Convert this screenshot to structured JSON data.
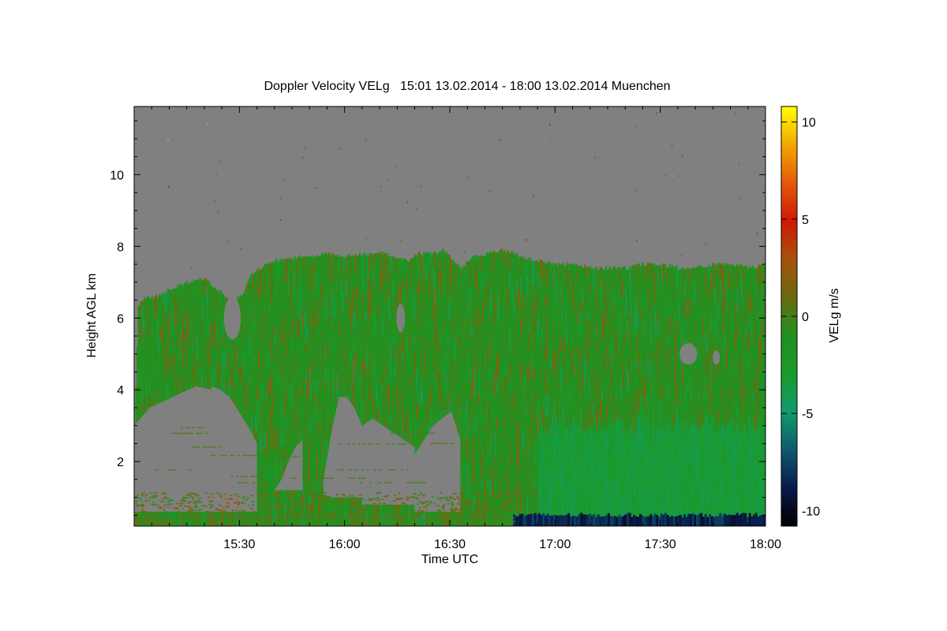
{
  "chart_data": {
    "type": "heatmap",
    "title": "Doppler Velocity VELg   15:01 13.02.2014 - 18:00 13.02.2014 Muenchen",
    "xlabel": "Time UTC",
    "ylabel": "Height AGL km",
    "colorbar_label": "VELg m/s",
    "x_tick_labels": [
      "15:30",
      "16:00",
      "16:30",
      "17:00",
      "17:30",
      "18:00"
    ],
    "x_tick_minutes": [
      30,
      60,
      90,
      120,
      150,
      180
    ],
    "xlim_minutes": [
      0,
      180
    ],
    "y_ticks": [
      2,
      4,
      6,
      8,
      10
    ],
    "y_tick_labels": [
      "2",
      "4",
      "6",
      "8",
      "10"
    ],
    "ylim": [
      0.2,
      11.9
    ],
    "colorbar_ticks": [
      -10,
      -5,
      0,
      5,
      10
    ],
    "colorbar_tick_labels": [
      "-10",
      "-5",
      "0",
      "5",
      "10"
    ],
    "clim": [
      -10.8,
      10.8
    ],
    "no_data_color": "#808080",
    "colormap": [
      "#000000",
      "#0a1a4a",
      "#0e5a6e",
      "#109c6c",
      "#1a9a2a",
      "#219120",
      "#6a6a10",
      "#a8520a",
      "#d01808",
      "#e45a08",
      "#f2a800",
      "#ffff00"
    ],
    "cloud_top_km": [
      [
        0,
        3.0
      ],
      [
        1,
        6.3
      ],
      [
        3,
        6.6
      ],
      [
        6,
        6.6
      ],
      [
        10,
        6.8
      ],
      [
        15,
        7.0
      ],
      [
        20,
        7.1
      ],
      [
        22,
        6.9
      ],
      [
        25,
        6.7
      ],
      [
        28,
        6.4
      ],
      [
        31,
        6.7
      ],
      [
        33,
        7.2
      ],
      [
        36,
        7.4
      ],
      [
        40,
        7.6
      ],
      [
        45,
        7.7
      ],
      [
        50,
        7.7
      ],
      [
        53,
        7.8
      ],
      [
        56,
        7.8
      ],
      [
        60,
        7.7
      ],
      [
        65,
        7.8
      ],
      [
        70,
        7.8
      ],
      [
        75,
        7.7
      ],
      [
        78,
        7.6
      ],
      [
        81,
        7.8
      ],
      [
        85,
        7.8
      ],
      [
        88,
        7.9
      ],
      [
        90,
        7.7
      ],
      [
        93,
        7.4
      ],
      [
        96,
        7.7
      ],
      [
        100,
        7.8
      ],
      [
        105,
        7.9
      ],
      [
        108,
        7.8
      ],
      [
        110,
        7.7
      ],
      [
        115,
        7.6
      ],
      [
        120,
        7.5
      ],
      [
        125,
        7.5
      ],
      [
        130,
        7.4
      ],
      [
        135,
        7.4
      ],
      [
        140,
        7.4
      ],
      [
        145,
        7.5
      ],
      [
        150,
        7.5
      ],
      [
        155,
        7.4
      ],
      [
        160,
        7.4
      ],
      [
        165,
        7.5
      ],
      [
        170,
        7.5
      ],
      [
        175,
        7.4
      ],
      [
        180,
        7.5
      ]
    ],
    "gaps": [
      {
        "x": [
          0,
          22
        ],
        "base_km": 0.6,
        "top_km": [
          3.0,
          3.5,
          3.7,
          3.9,
          4.1,
          4.0
        ]
      },
      {
        "x": [
          22,
          35
        ],
        "base_km": 0.6,
        "top_km": [
          4.1,
          4.0,
          3.8,
          3.4,
          3.0,
          2.5
        ]
      },
      {
        "x": [
          40,
          48
        ],
        "base_km": 1.2,
        "top_km": [
          1.2,
          1.5,
          2.0,
          2.4,
          2.6
        ]
      },
      {
        "x": [
          54,
          65
        ],
        "base_km": 1.0,
        "top_km": [
          1.5,
          2.8,
          3.8,
          3.8,
          3.5,
          3.0
        ]
      },
      {
        "x": [
          65,
          80
        ],
        "base_km": 0.8,
        "top_km": [
          3.0,
          3.2,
          3.0,
          2.8,
          2.6,
          2.4
        ]
      },
      {
        "x": [
          80,
          93
        ],
        "base_km": 0.6,
        "top_km": [
          2.2,
          2.6,
          3.0,
          3.2,
          3.4,
          2.6
        ]
      }
    ],
    "holes": [
      {
        "cx": 28,
        "cy": 6.0,
        "rx": 2.4,
        "ry": 0.6
      },
      {
        "cx": 76,
        "cy": 6.0,
        "rx": 1.2,
        "ry": 0.4
      },
      {
        "cx": 158,
        "cy": 5.0,
        "rx": 2.5,
        "ry": 0.3
      },
      {
        "cx": 166,
        "cy": 4.9,
        "rx": 1.0,
        "ry": 0.2
      }
    ],
    "surface_layer": {
      "x": [
        108,
        180
      ],
      "top_km": 0.5,
      "value": -8.5
    }
  }
}
